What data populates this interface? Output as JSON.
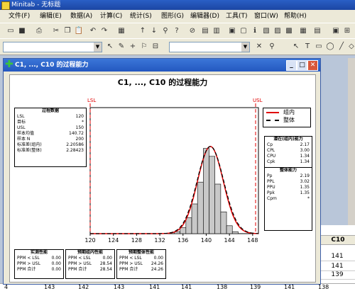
{
  "window": {
    "title": "Minitab - 无标题"
  },
  "menu": [
    {
      "label": "文件(F)"
    },
    {
      "label": "编辑(E)"
    },
    {
      "label": "数据(A)"
    },
    {
      "label": "计算(C)"
    },
    {
      "label": "统计(S)"
    },
    {
      "label": "图形(G)"
    },
    {
      "label": "编辑器(D)"
    },
    {
      "label": "工具(T)"
    },
    {
      "label": "窗口(W)"
    },
    {
      "label": "帮助(H)"
    }
  ],
  "graph_window": {
    "title": "C1, ..., C10 的过程能力"
  },
  "plot": {
    "title": "C1, ..., C10 的过程能力",
    "lsl_label": "LSL",
    "usl_label": "USL"
  },
  "process_data": {
    "header": "过程数据",
    "rows": [
      {
        "label": "LSL",
        "value": "120"
      },
      {
        "label": "目标",
        "value": "*"
      },
      {
        "label": "USL",
        "value": "150"
      },
      {
        "label": "样本均值",
        "value": "140.72"
      },
      {
        "label": "样本 N",
        "value": "200"
      },
      {
        "label": "标准差(组内)",
        "value": "2.20586"
      },
      {
        "label": "标准差(整体)",
        "value": "2.28423"
      }
    ]
  },
  "legend": {
    "within": "组内",
    "overall": "整体"
  },
  "potential": {
    "header": "潜在(组内)能力",
    "rows": [
      {
        "label": "Cp",
        "value": "2.17"
      },
      {
        "label": "CPL",
        "value": "3.00"
      },
      {
        "label": "CPU",
        "value": "1.34"
      },
      {
        "label": "Cpk",
        "value": "1.34"
      }
    ]
  },
  "overall_cap": {
    "header": "整体能力",
    "rows": [
      {
        "label": "Pp",
        "value": "2.19"
      },
      {
        "label": "PPL",
        "value": "3.02"
      },
      {
        "label": "PPU",
        "value": "1.35"
      },
      {
        "label": "Ppk",
        "value": "1.35"
      },
      {
        "label": "Cpm",
        "value": "*"
      }
    ]
  },
  "observed": {
    "header": "实测性能",
    "rows": [
      {
        "label": "PPM < LSL",
        "value": "0.00"
      },
      {
        "label": "PPM > USL",
        "value": "0.00"
      },
      {
        "label": "PPM 合计",
        "value": "0.00"
      }
    ]
  },
  "exp_within": {
    "header": "预期组内性能",
    "rows": [
      {
        "label": "PPM < LSL",
        "value": "0.00"
      },
      {
        "label": "PPM > USL",
        "value": "28.54"
      },
      {
        "label": "PPM 合计",
        "value": "28.54"
      }
    ]
  },
  "exp_overall": {
    "header": "预期整体性能",
    "rows": [
      {
        "label": "PPM < LSL",
        "value": "0.00"
      },
      {
        "label": "PPM > USL",
        "value": "24.26"
      },
      {
        "label": "PPM 合计",
        "value": "24.26"
      }
    ]
  },
  "chart_data": {
    "type": "bar",
    "title": "C1, ..., C10 的过程能力",
    "xlabel": "",
    "ylabel": "",
    "xlim": [
      120,
      149
    ],
    "x_ticks": [
      "120",
      "124",
      "128",
      "132",
      "136",
      "140",
      "144",
      "148"
    ],
    "bins": [
      {
        "x0": 134.5,
        "x1": 135.5,
        "y": 0.02
      },
      {
        "x0": 135.5,
        "x1": 136.5,
        "y": 0.06
      },
      {
        "x0": 136.5,
        "x1": 137.5,
        "y": 0.16
      },
      {
        "x0": 137.5,
        "x1": 138.5,
        "y": 0.3
      },
      {
        "x0": 138.5,
        "x1": 139.5,
        "y": 0.52
      },
      {
        "x0": 139.5,
        "x1": 140.5,
        "y": 0.86
      },
      {
        "x0": 140.5,
        "x1": 141.5,
        "y": 0.78
      },
      {
        "x0": 141.5,
        "x1": 142.5,
        "y": 0.5
      },
      {
        "x0": 142.5,
        "x1": 143.5,
        "y": 0.22
      },
      {
        "x0": 143.5,
        "x1": 144.5,
        "y": 0.08
      },
      {
        "x0": 144.5,
        "x1": 145.5,
        "y": 0.02
      }
    ],
    "lsl": 120,
    "usl": 150,
    "mean": 140.72,
    "sd_within": 2.20586,
    "sd_overall": 2.28423,
    "colors": {
      "bars": "#c8c8c8",
      "within": "#e00000",
      "overall": "#000000",
      "limits": "#e00000"
    }
  },
  "worksheet": {
    "col_header": "C10",
    "cells": [
      "141",
      "141",
      "139"
    ]
  },
  "bottom_row": {
    "num": "4",
    "values": [
      "143",
      "142",
      "143",
      "141",
      "141",
      "138",
      "139",
      "141",
      "138"
    ]
  }
}
